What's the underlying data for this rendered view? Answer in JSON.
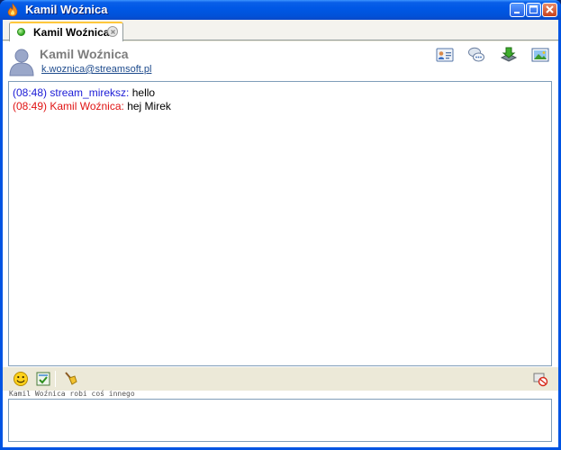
{
  "window": {
    "title": "Kamil Woźnica",
    "buttons": [
      "minimize",
      "maximize",
      "close"
    ]
  },
  "tab": {
    "label": "Kamil Woźnica",
    "status": "online"
  },
  "contact": {
    "name": "Kamil Woźnica",
    "email": "k.woznica@streamsoft.pl"
  },
  "header_icons": [
    "contact-card-icon",
    "chat-bubbles-icon",
    "download-icon",
    "image-icon"
  ],
  "messages": [
    {
      "time": "(08:48)",
      "sender": "stream_mireksz:",
      "text": "hello",
      "color": "#1b1bd6"
    },
    {
      "time": "(08:49)",
      "sender": "Kamil Woźnica:",
      "text": "hej Mirek",
      "color": "#e01414"
    }
  ],
  "toolbar_icons": [
    "smiley-icon",
    "checklist-icon",
    "broom-icon",
    "block-icon"
  ],
  "status_line": "Kamil Woźnica robi coś innego",
  "input": {
    "value": ""
  },
  "colors": {
    "titlebar": "#0058e6",
    "window_bg": "#ece9d8",
    "accent_tab": "#ffc83c"
  }
}
